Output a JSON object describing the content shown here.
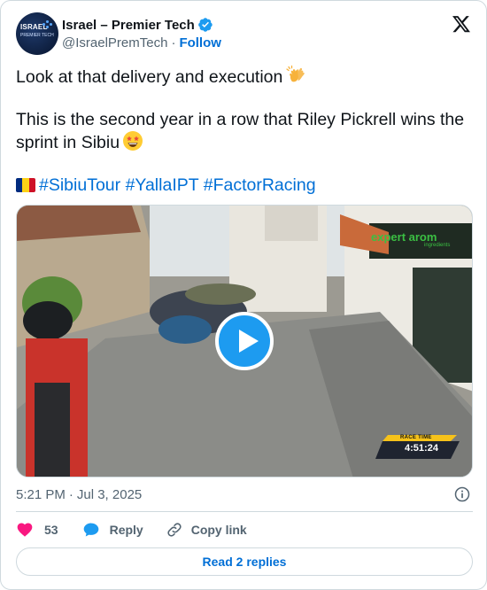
{
  "author": {
    "name": "Israel – Premier Tech",
    "handle": "@IsraelPremTech",
    "separator": "·",
    "follow_label": "Follow",
    "avatar_text_top": "ISRAEL",
    "avatar_text_bottom": "PREMIER TECH",
    "verified_color": "#1d9bf0"
  },
  "platform": {
    "logo": "x-logo-icon"
  },
  "tweet": {
    "line1": "Look at that delivery and execution",
    "line1_emoji": "clapping-hands-icon",
    "line2": "This is the second year in a row that Riley Pickrell wins the sprint in Sibiu",
    "line2_emoji": "star-struck-face-icon",
    "flag": "romania-flag-icon",
    "hashtags": [
      "#SibiuTour",
      "#YallaIPT",
      "#FactorRacing"
    ]
  },
  "media": {
    "type": "video",
    "sponsor": "expert arom",
    "sponsor_sub": "ingredients",
    "race_time_label": "RACE TIME",
    "race_time": "4:51:24",
    "play_icon": "play-icon"
  },
  "meta": {
    "time": "5:21 PM",
    "separator": "·",
    "date": "Jul 3, 2025",
    "info_icon": "info-icon"
  },
  "actions": {
    "like_count": "53",
    "reply_label": "Reply",
    "copy_label": "Copy link"
  },
  "footer": {
    "read_replies_label": "Read 2 replies"
  },
  "colors": {
    "accent": "#006fd6",
    "like": "#f91880",
    "border": "#cfd9de",
    "secondary_text": "#536471"
  }
}
